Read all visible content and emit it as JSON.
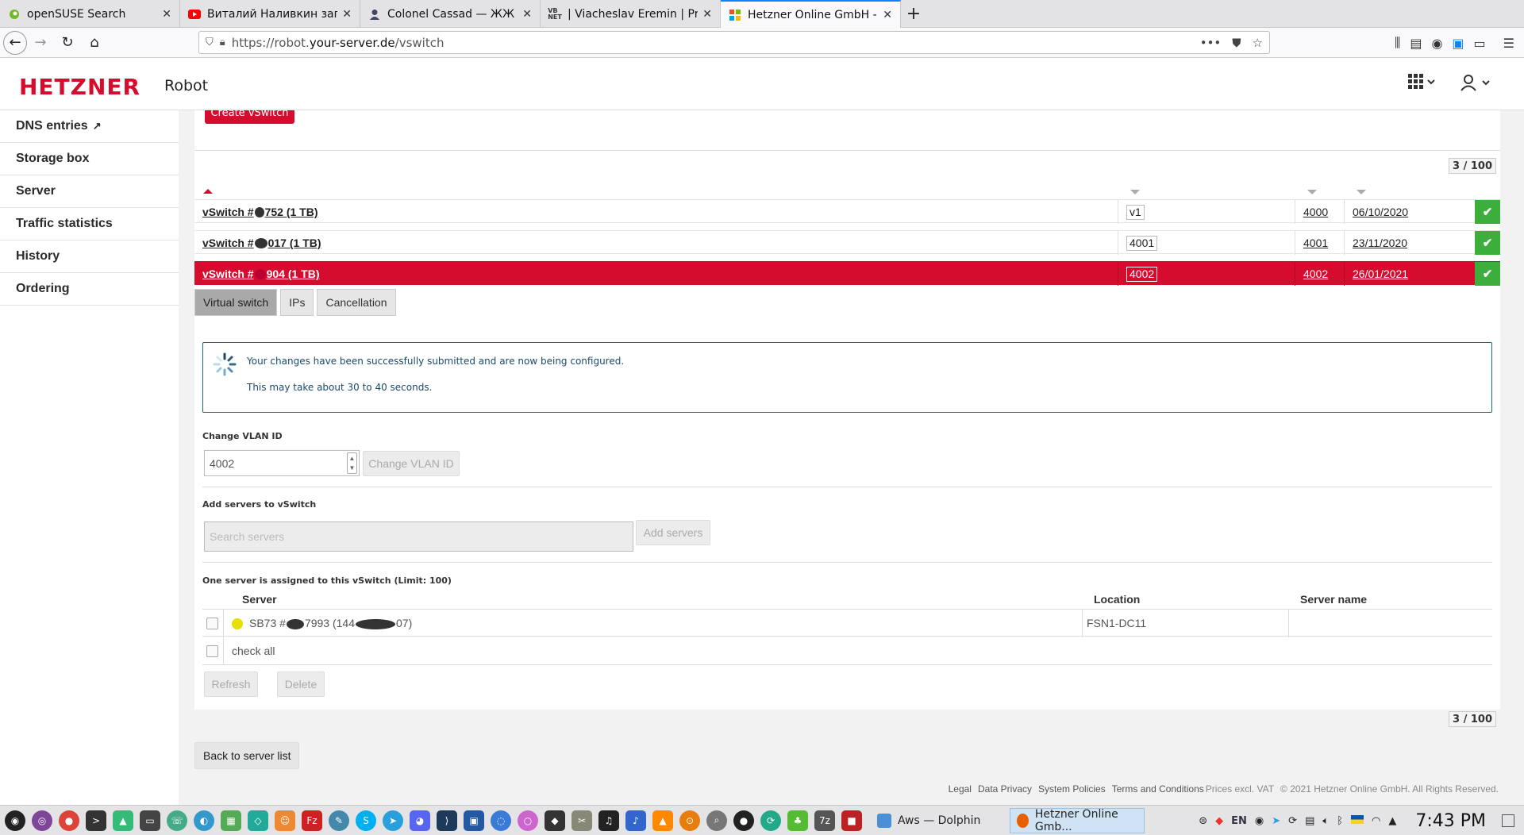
{
  "browser": {
    "tabs": [
      {
        "label": "openSUSE Search",
        "icon": "opensuse-icon",
        "active": false
      },
      {
        "label": "Виталий Наливкин запро",
        "icon": "youtube-icon",
        "active": false
      },
      {
        "label": "Colonel Cassad — ЖЖ",
        "icon": "user-icon",
        "active": false
      },
      {
        "label": "| Viacheslav Eremin | Prof",
        "icon": "site-icon",
        "active": false
      },
      {
        "label": "Hetzner Online GmbH - Ro",
        "icon": "hetzner-icon",
        "active": true
      }
    ],
    "new_tab": "+",
    "url_base": "https://robot.",
    "url_domain": "your-server.de",
    "url_path": "/vswitch"
  },
  "header": {
    "logo": "HETZNER",
    "product": "Robot"
  },
  "sidebar": {
    "items": [
      {
        "label": "DNS entries"
      },
      {
        "label": "Storage box"
      },
      {
        "label": "Server"
      },
      {
        "label": "Traffic statistics"
      },
      {
        "label": "History"
      },
      {
        "label": "Ordering"
      }
    ]
  },
  "main": {
    "create_label": "Create vSwitch",
    "counter": "3 / 100",
    "vswitches": [
      {
        "prefix": "vSwitch #",
        "suffix": "752 (1 TB)",
        "name": "v1",
        "vlan": "4000",
        "date": "06/10/2020",
        "active": false
      },
      {
        "prefix": "vSwitch #",
        "suffix": "017 (1 TB)",
        "name": "4001",
        "vlan": "4001",
        "date": "23/11/2020",
        "active": false
      },
      {
        "prefix": "vSwitch #",
        "suffix": "904 (1 TB)",
        "name": "4002",
        "vlan": "4002",
        "date": "26/01/2021",
        "active": true
      }
    ],
    "subtabs": [
      "Virtual switch",
      "IPs",
      "Cancellation"
    ],
    "notice": {
      "line1": "Your changes have been successfully submitted and are now being configured.",
      "line2": "This may take about 30 to 40 seconds."
    },
    "vlan_section": {
      "label": "Change VLAN ID",
      "value": "4002",
      "button": "Change VLAN ID"
    },
    "servers_section": {
      "label": "Add servers to vSwitch",
      "placeholder": "Search servers",
      "button": "Add servers"
    },
    "assigned": {
      "label": "One server is assigned to this vSwitch (Limit: 100)",
      "headers": {
        "server": "Server",
        "location": "Location",
        "server_name": "Server name"
      },
      "rows": [
        {
          "server_prefix": "SB73 #",
          "server_mid": "7993 (144",
          "server_suffix": "07)",
          "location": "FSN1-DC11",
          "server_name": ""
        }
      ],
      "check_all": "check all",
      "refresh": "Refresh",
      "delete": "Delete"
    },
    "back_label": "Back to server list"
  },
  "footer": {
    "links": [
      "Legal",
      "Data Privacy",
      "System Policies",
      "Terms and Conditions"
    ],
    "prices": "Prices excl. VAT",
    "copyright": "© 2021 Hetzner Online GmbH. All Rights Reserved."
  },
  "taskbar": {
    "tasks": [
      {
        "label": "Aws — Dolphin",
        "active": false
      },
      {
        "label": "Hetzner Online Gmb...",
        "active": true
      }
    ],
    "lang": "EN",
    "clock": "7:43 PM"
  },
  "colors": {
    "brand": "#d50c2d",
    "success": "#3cae3c"
  }
}
